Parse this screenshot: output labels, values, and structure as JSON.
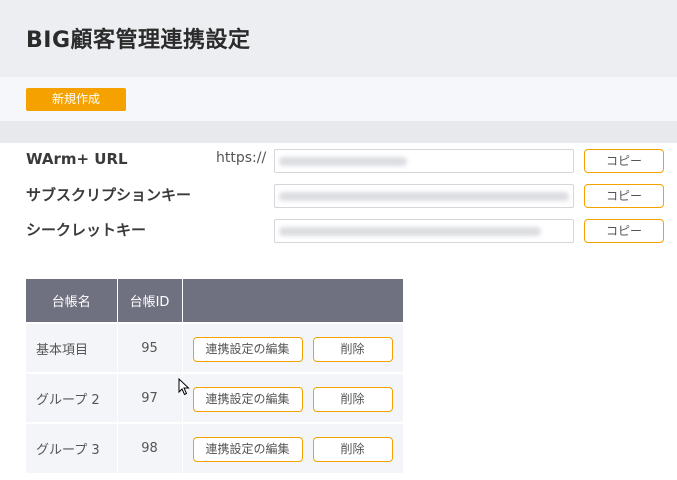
{
  "page": {
    "title": "BIG顧客管理連携設定",
    "new_button": "新規作成"
  },
  "settings": {
    "warm_url": {
      "label": "WArm+ URL",
      "prefix": "https://",
      "value": "",
      "copy": "コピー"
    },
    "subscription_key": {
      "label": "サブスクリプションキー",
      "value": "",
      "copy": "コピー"
    },
    "secret_key": {
      "label": "シークレットキー",
      "value": "",
      "copy": "コピー"
    }
  },
  "table": {
    "headers": {
      "name": "台帳名",
      "id": "台帳ID",
      "actions": ""
    },
    "rows": [
      {
        "name": "基本項目",
        "id": "95",
        "edit": "連携設定の編集",
        "delete": "削除"
      },
      {
        "name": "グループ 2",
        "id": "97",
        "edit": "連携設定の編集",
        "delete": "削除"
      },
      {
        "name": "グループ 3",
        "id": "98",
        "edit": "連携設定の編集",
        "delete": "削除"
      }
    ]
  },
  "colors": {
    "accent": "#f5a200",
    "header_bg": "#eceef2",
    "table_header_bg": "#707180"
  }
}
